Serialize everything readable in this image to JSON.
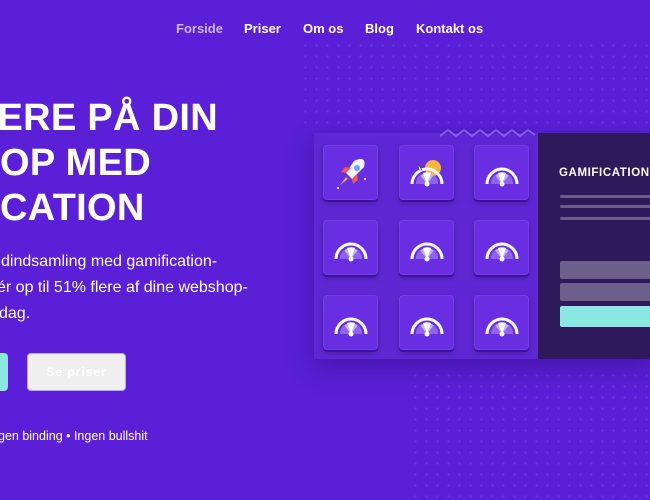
{
  "nav": {
    "items": [
      {
        "label": "Forside",
        "active": true
      },
      {
        "label": "Priser"
      },
      {
        "label": "Om os"
      },
      {
        "label": "Blog"
      },
      {
        "label": "Kontakt os"
      }
    ]
  },
  "hero": {
    "headline_lines": [
      "HERE PÅ DIN",
      "OP MED",
      "CATION"
    ],
    "sub_lines": [
      "dindsamling med gamification-",
      "ér op til 51% flere af dine webshop-",
      "dag."
    ],
    "secondary_button": "Se priser",
    "note": "gen binding • Ingen bullshit"
  },
  "illustration": {
    "panel_title": "GAMIFICATION U",
    "tiles": [
      {
        "icon": "rocket-icon"
      },
      {
        "icon": "wheel-highlight-icon"
      },
      {
        "icon": "wheel-icon"
      },
      {
        "icon": "wheel-icon"
      },
      {
        "icon": "wheel-icon"
      },
      {
        "icon": "wheel-icon"
      },
      {
        "icon": "wheel-icon"
      },
      {
        "icon": "wheel-icon"
      },
      {
        "icon": "wheel-icon"
      }
    ]
  },
  "colors": {
    "background": "#5a1fd6",
    "accent": "#8be8e0",
    "panel": "#2e1a5a",
    "nav_active": "#cbb8f7"
  }
}
